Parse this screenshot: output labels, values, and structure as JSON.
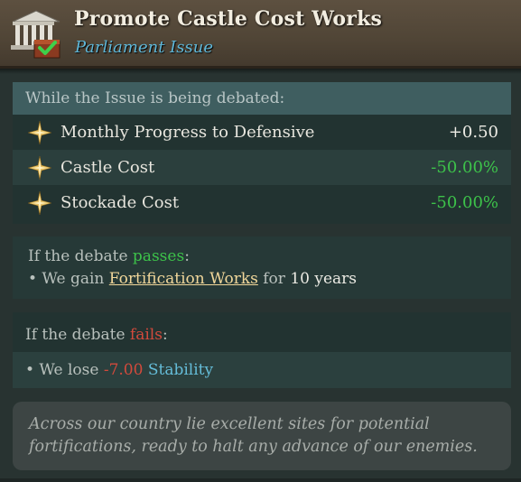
{
  "header": {
    "title": "Promote Castle Cost Works",
    "subtitle": "Parliament Issue",
    "icon": "parliament-building-icon"
  },
  "debated": {
    "heading": "While the Issue is being debated:",
    "effects": [
      {
        "label": "Monthly Progress to Defensive",
        "value": "+0.50",
        "icon": "star-icon",
        "tone": "neutral"
      },
      {
        "label": "Castle Cost",
        "value": "-50.00%",
        "icon": "star-icon",
        "tone": "good"
      },
      {
        "label": "Stockade Cost",
        "value": "-50.00%",
        "icon": "star-icon",
        "tone": "good"
      }
    ]
  },
  "passes": {
    "prefix": "If the debate ",
    "keyword": "passes",
    "suffix": ":",
    "bullet": "• We gain ",
    "link": "Fortification Works",
    "for_text": " for ",
    "duration": "10 years"
  },
  "fails": {
    "prefix": "If the debate ",
    "keyword": "fails",
    "suffix": ":",
    "bullet": "• We lose ",
    "amount": "-7.00",
    "stat": "Stability"
  },
  "flavor": {
    "text": "Across our country lie excellent sites for potential fortifications, ready to halt any advance of our enemies."
  },
  "colors": {
    "positive": "#3dc24a",
    "negative": "#d24a3c",
    "accent_blue": "#5fb7d8",
    "link_gold": "#f1d79a"
  }
}
